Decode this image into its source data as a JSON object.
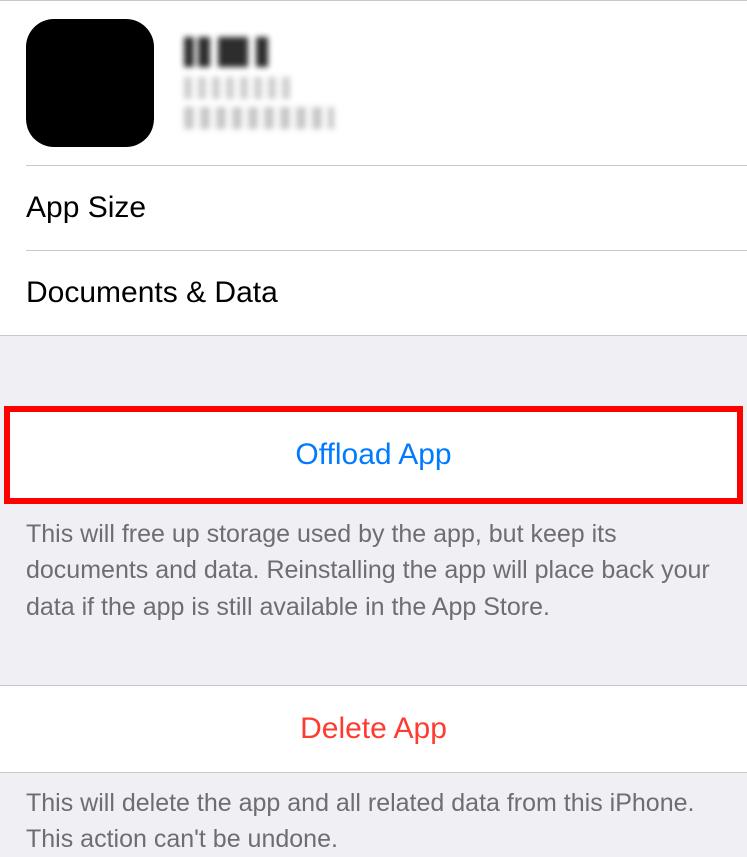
{
  "header": {
    "app_name": "[redacted]",
    "app_subtitle": "[redacted]",
    "app_developer": "[redacted]"
  },
  "info": {
    "app_size_label": "App Size",
    "documents_data_label": "Documents & Data"
  },
  "actions": {
    "offload_label": "Offload App",
    "offload_description": "This will free up storage used by the app, but keep its documents and data. Reinstalling the app will place back your data if the app is still available in the App Store.",
    "delete_label": "Delete App",
    "delete_description": "This will delete the app and all related data from this iPhone. This action can't be undone."
  }
}
